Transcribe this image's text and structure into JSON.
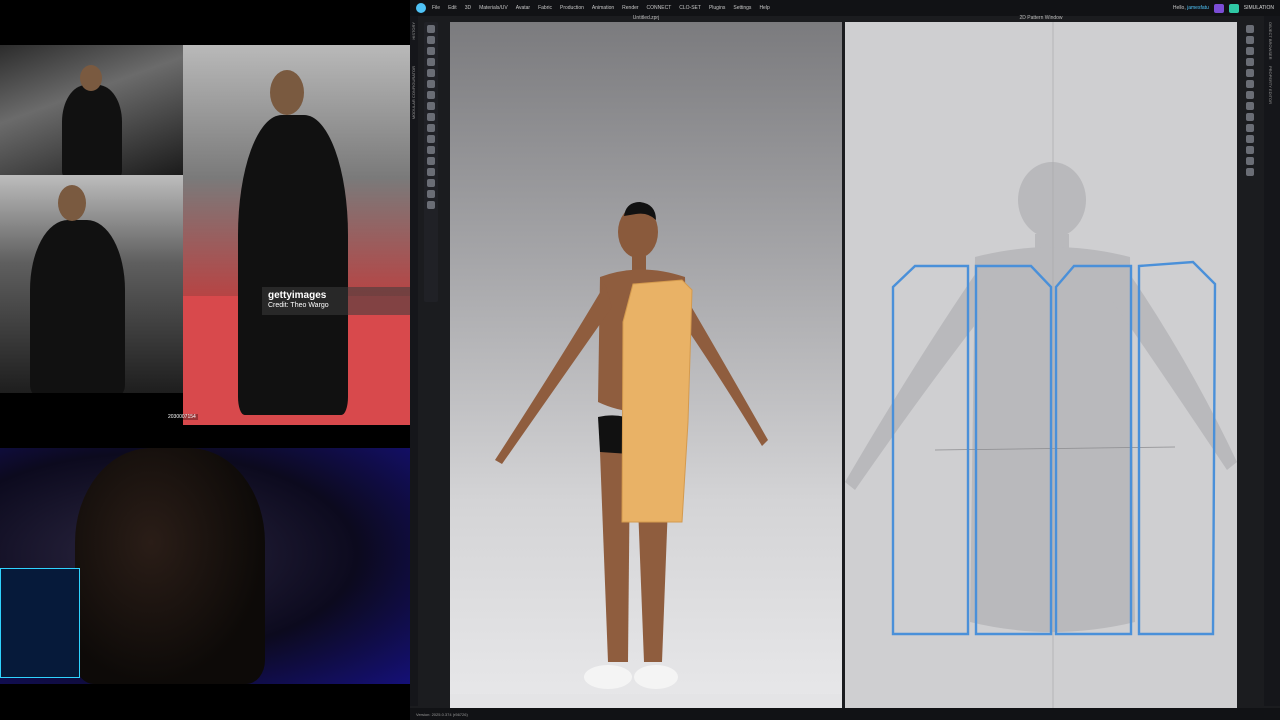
{
  "references": {
    "watermark_brand": "gettyimages",
    "watermark_credit": "Credit: Theo Wargo",
    "photo_id": "2030007154"
  },
  "app": {
    "menu": [
      "File",
      "Edit",
      "3D",
      "Materials/UV",
      "Avatar",
      "Fabric",
      "Production",
      "Animation",
      "Render",
      "CONNECT",
      "CLO-SET",
      "Plugins",
      "Settings",
      "Help"
    ],
    "greeting_prefix": "Hello, ",
    "user": "jamesfatu",
    "mode": "SIMULATION",
    "left_labels": [
      "HISTORY",
      "MODULAR CONFIGURATOR"
    ],
    "right_labels": [
      "OBJECT BROWSER",
      "PROPERTY EDITOR"
    ],
    "viewport_title": "Untitled.zprj",
    "pattern_title": "2D Pattern Window",
    "status": "Version: 2025.0.374 (r56726)",
    "accent": "#4fc3f7",
    "pattern_line": "#4a90d9"
  }
}
